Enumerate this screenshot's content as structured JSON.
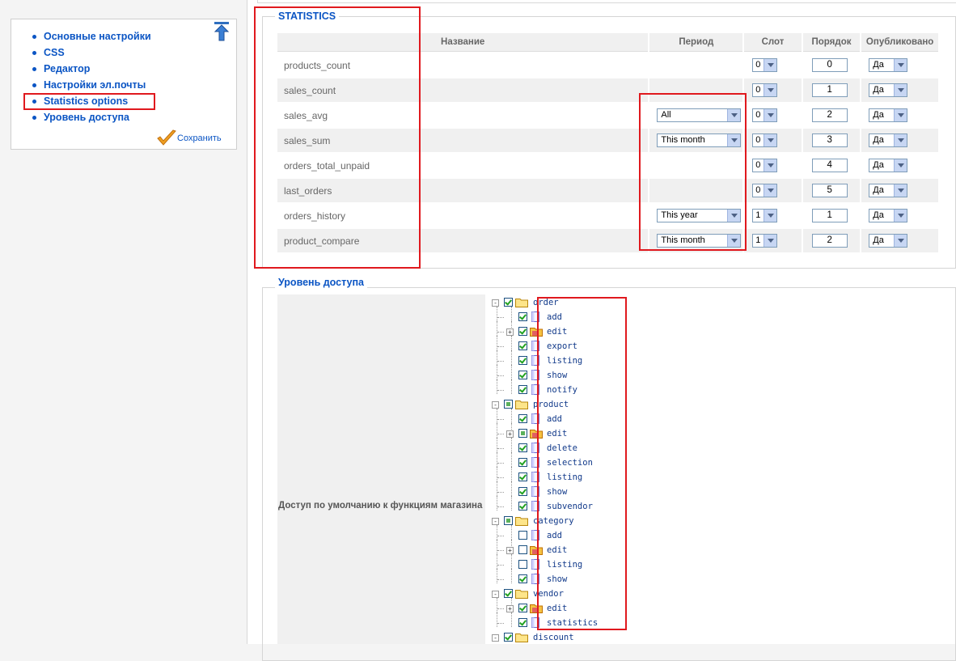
{
  "sidebar": {
    "items": [
      {
        "label": "Основные настройки"
      },
      {
        "label": "CSS"
      },
      {
        "label": "Редактор"
      },
      {
        "label": "Настройки эл.почты"
      },
      {
        "label": "Statistics options"
      },
      {
        "label": "Уровень доступа"
      }
    ],
    "save_label": "Сохранить",
    "up_icon": "arrow-up-icon",
    "save_icon": "checkmark-icon"
  },
  "statistics": {
    "legend": "STATISTICS",
    "headers": {
      "name": "Название",
      "period": "Период",
      "slot": "Слот",
      "order": "Порядок",
      "published": "Опубликовано"
    },
    "rows": [
      {
        "name": "products_count",
        "period": "",
        "slot": "0",
        "order": "0",
        "published": "Да"
      },
      {
        "name": "sales_count",
        "period": "",
        "slot": "0",
        "order": "1",
        "published": "Да"
      },
      {
        "name": "sales_avg",
        "period": "All",
        "slot": "0",
        "order": "2",
        "published": "Да"
      },
      {
        "name": "sales_sum",
        "period": "This month",
        "slot": "0",
        "order": "3",
        "published": "Да"
      },
      {
        "name": "orders_total_unpaid",
        "period": "",
        "slot": "0",
        "order": "4",
        "published": "Да"
      },
      {
        "name": "last_orders",
        "period": "",
        "slot": "0",
        "order": "5",
        "published": "Да"
      },
      {
        "name": "orders_history",
        "period": "This year",
        "slot": "1",
        "order": "1",
        "published": "Да"
      },
      {
        "name": "product_compare",
        "period": "This month",
        "slot": "1",
        "order": "2",
        "published": "Да"
      }
    ]
  },
  "access": {
    "legend": "Уровень доступа",
    "label": "Доступ по умолчанию к функциям магазина",
    "tree": [
      {
        "label": "order",
        "level": 0,
        "state": "on",
        "folder": true,
        "expand": "-"
      },
      {
        "label": "add",
        "level": 1,
        "state": "on",
        "folder": false
      },
      {
        "label": "edit",
        "level": 1,
        "state": "on",
        "folder": true,
        "expand": "+"
      },
      {
        "label": "export",
        "level": 1,
        "state": "on",
        "folder": false
      },
      {
        "label": "listing",
        "level": 1,
        "state": "on",
        "folder": false
      },
      {
        "label": "show",
        "level": 1,
        "state": "on",
        "folder": false
      },
      {
        "label": "notify",
        "level": 1,
        "state": "on",
        "folder": false
      },
      {
        "label": "product",
        "level": 0,
        "state": "part",
        "folder": true,
        "expand": "-"
      },
      {
        "label": "add",
        "level": 1,
        "state": "on",
        "folder": false
      },
      {
        "label": "edit",
        "level": 1,
        "state": "part",
        "folder": true,
        "expand": "+"
      },
      {
        "label": "delete",
        "level": 1,
        "state": "on",
        "folder": false
      },
      {
        "label": "selection",
        "level": 1,
        "state": "on",
        "folder": false
      },
      {
        "label": "listing",
        "level": 1,
        "state": "on",
        "folder": false
      },
      {
        "label": "show",
        "level": 1,
        "state": "on",
        "folder": false
      },
      {
        "label": "subvendor",
        "level": 1,
        "state": "on",
        "folder": false
      },
      {
        "label": "category",
        "level": 0,
        "state": "part",
        "folder": true,
        "expand": "-"
      },
      {
        "label": "add",
        "level": 1,
        "state": "off",
        "folder": false
      },
      {
        "label": "edit",
        "level": 1,
        "state": "off",
        "folder": true,
        "expand": "+"
      },
      {
        "label": "listing",
        "level": 1,
        "state": "off",
        "folder": false
      },
      {
        "label": "show",
        "level": 1,
        "state": "on",
        "folder": false
      },
      {
        "label": "vendor",
        "level": 0,
        "state": "on",
        "folder": true,
        "expand": "-"
      },
      {
        "label": "edit",
        "level": 1,
        "state": "on",
        "folder": true,
        "expand": "+"
      },
      {
        "label": "statistics",
        "level": 1,
        "state": "on",
        "folder": false
      },
      {
        "label": "discount",
        "level": 0,
        "state": "on",
        "folder": true,
        "expand": "-"
      }
    ]
  }
}
